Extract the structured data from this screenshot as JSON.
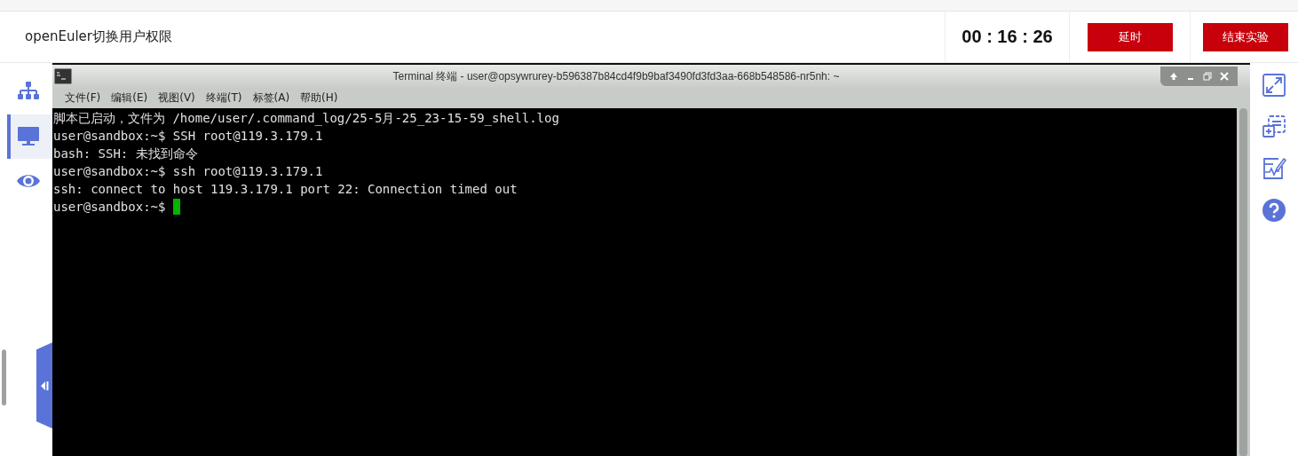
{
  "header": {
    "title": "openEuler切换用户权限",
    "timer": "00 : 16 : 26",
    "buttons": [
      {
        "label": "延时"
      },
      {
        "label": "结束实验"
      }
    ]
  },
  "sidebar": {
    "items": [
      {
        "selected": false
      },
      {
        "selected": true
      },
      {
        "selected": false
      }
    ]
  },
  "terminal": {
    "title": "Terminal 终端 - user@opsywrurey-b596387b84cd4f9b9baf3490fd3fd3aa-668b548586-nr5nh: ~",
    "menu": [
      "文件(F)",
      "编辑(E)",
      "视图(V)",
      "终端(T)",
      "标签(A)",
      "帮助(H)"
    ],
    "lines": [
      "脚本已启动，文件为 /home/user/.command_log/25-5月-25_23-15-59_shell.log",
      "user@sandbox:~$ SSH root@119.3.179.1",
      "bash: SSH: 未找到命令",
      "user@sandbox:~$ ssh root@119.3.179.1",
      "ssh: connect to host 119.3.179.1 port 22: Connection timed out"
    ],
    "prompt": "user@sandbox:~$ "
  }
}
